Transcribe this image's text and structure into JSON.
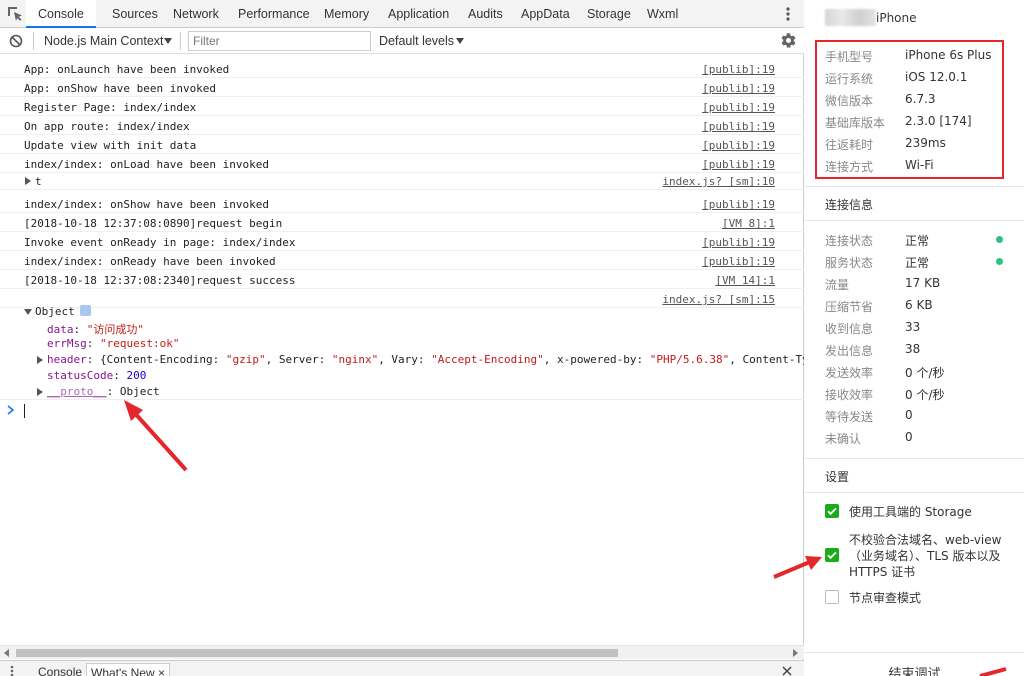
{
  "devtools": {
    "tabs": [
      {
        "label": "Console",
        "active": true
      },
      {
        "label": "Sources"
      },
      {
        "label": "Network"
      },
      {
        "label": "Performance"
      },
      {
        "label": "Memory"
      },
      {
        "label": "Application"
      },
      {
        "label": "Audits"
      },
      {
        "label": "AppData"
      },
      {
        "label": "Storage"
      },
      {
        "label": "Wxml"
      }
    ],
    "toolbar": {
      "context": "Node.js Main Context",
      "filter_placeholder": "Filter",
      "levels": "Default levels"
    },
    "logs": [
      {
        "msg": "App: onLaunch have been invoked",
        "src": "[publib]:19"
      },
      {
        "msg": "App: onShow have been invoked",
        "src": "[publib]:19"
      },
      {
        "msg": "Register Page: index/index",
        "src": "[publib]:19"
      },
      {
        "msg": "On app route: index/index",
        "src": "[publib]:19"
      },
      {
        "msg": "Update view with init data",
        "src": "[publib]:19"
      },
      {
        "msg": "index/index: onLoad have been invoked",
        "src": "[publib]:19"
      },
      {
        "msg": "t",
        "src": "index.js? [sm]:10",
        "collapsible": true
      },
      {
        "msg": "index/index: onShow have been invoked",
        "src": "[publib]:19"
      },
      {
        "msg": "[2018-10-18 12:37:08:0890]request begin",
        "src": "[VM 8]:1"
      },
      {
        "msg": "Invoke event onReady in page: index/index",
        "src": "[publib]:19"
      },
      {
        "msg": "index/index: onReady have been invoked",
        "src": "[publib]:19"
      },
      {
        "msg": "[2018-10-18 12:37:08:2340]request success",
        "src": "[VM 14]:1"
      },
      {
        "msg": "",
        "src": "index.js? [sm]:15"
      }
    ],
    "object": {
      "label": "Object",
      "data_key": "data",
      "data_val": "\"访问成功\"",
      "errmsg_key": "errMsg",
      "errmsg_val": "\"request:ok\"",
      "header_key": "header",
      "header_p1": "{Content-Encoding: ",
      "header_s1": "\"gzip\"",
      "header_p2": ", Server: ",
      "header_s2": "\"nginx\"",
      "header_p3": ", Vary: ",
      "header_s3": "\"Accept-Encoding\"",
      "header_p4": ", x-powered-by: ",
      "header_s4": "\"PHP/5.6.38\"",
      "header_p5": ", Content-Ty",
      "status_key": "statusCode",
      "status_val": "200",
      "proto_key": "__proto__",
      "proto_val": ": Object"
    },
    "drawer": {
      "tabs": [
        {
          "label": "Console"
        },
        {
          "label": "What's New ×"
        }
      ]
    }
  },
  "panel": {
    "device_name": "iPhone",
    "device_info": [
      {
        "key": "手机型号",
        "val": "iPhone 6s Plus"
      },
      {
        "key": "运行系统",
        "val": "iOS 12.0.1"
      },
      {
        "key": "微信版本",
        "val": "6.7.3"
      },
      {
        "key": "基础库版本",
        "val": "2.3.0 [174]"
      },
      {
        "key": "往返耗时",
        "val": "239ms"
      },
      {
        "key": "连接方式",
        "val": "Wi-Fi"
      }
    ],
    "connection_title": "连接信息",
    "connection": [
      {
        "key": "连接状态",
        "val": "正常",
        "dot": true
      },
      {
        "key": "服务状态",
        "val": "正常",
        "dot": true
      },
      {
        "key": "流量",
        "val": "17 KB"
      },
      {
        "key": "压缩节省",
        "val": "6 KB"
      },
      {
        "key": "收到信息",
        "val": "33"
      },
      {
        "key": "发出信息",
        "val": "38"
      },
      {
        "key": "发送效率",
        "val": "0 个/秒"
      },
      {
        "key": "接收效率",
        "val": "0 个/秒"
      },
      {
        "key": "等待发送",
        "val": "0"
      },
      {
        "key": "未确认",
        "val": "0"
      }
    ],
    "settings_title": "设置",
    "settings": [
      {
        "label": "使用工具端的 Storage",
        "checked": true
      },
      {
        "label": "不校验合法域名、web-view（业务域名）、TLS 版本以及 HTTPS 证书",
        "checked": true
      },
      {
        "label": "节点审查模式",
        "checked": false
      }
    ],
    "end_debug": "结束调试"
  },
  "colors": {
    "accent_blue": "#1a73e8",
    "highlight_red": "#e5262a",
    "check_green": "#1aad19",
    "status_green": "#2ec27e",
    "string_red": "#c41a16",
    "key_purple": "#881391",
    "number_blue": "#1c00cf"
  }
}
